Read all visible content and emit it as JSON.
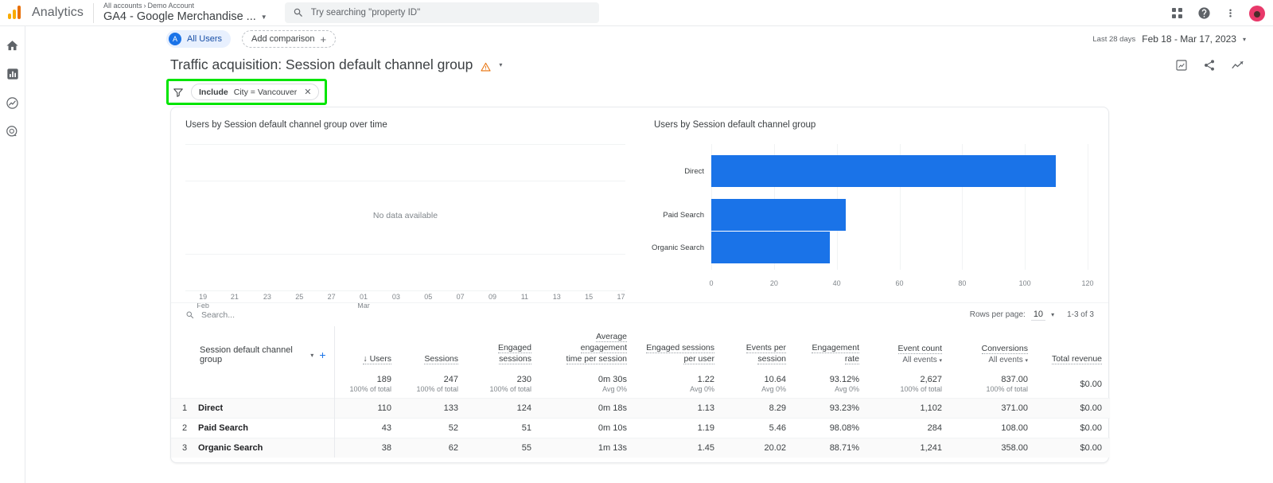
{
  "topbar": {
    "brand": "Analytics",
    "breadcrumb_accounts": "All accounts",
    "breadcrumb_sep": "›",
    "breadcrumb_account": "Demo Account",
    "property": "GA4 - Google Merchandise ...",
    "search_placeholder": "Try searching \"property ID\"",
    "icons": [
      "search-icon",
      "apps-grid-icon",
      "help-icon",
      "more-vert-icon",
      "avatar"
    ]
  },
  "sidebar": {
    "items": [
      {
        "name": "home",
        "icon": "home-icon"
      },
      {
        "name": "reports",
        "icon": "bar-chart-icon"
      },
      {
        "name": "explore",
        "icon": "explore-icon"
      },
      {
        "name": "advertising",
        "icon": "advertising-icon"
      }
    ]
  },
  "comparison": {
    "all_users_initial": "A",
    "all_users_label": "All Users",
    "add_comparison_label": "Add comparison",
    "add_comparison_plus": "+"
  },
  "daterange": {
    "relative": "Last 28 days",
    "absolute": "Feb 18 - Mar 17, 2023",
    "caret": "▾"
  },
  "report": {
    "title": "Traffic acquisition: Session default channel group",
    "warning_icon": "warning-triangle-icon",
    "title_caret": "▾",
    "actions": [
      "customize-report-icon",
      "share-icon",
      "insights-icon"
    ]
  },
  "filter": {
    "icon": "filter-funnel-icon",
    "include_label": "Include",
    "condition": "City = Vancouver",
    "remove": "✕",
    "highlight_color": "#00e500"
  },
  "chart_data": [
    {
      "type": "line",
      "title": "Users by Session default channel group over time",
      "empty_message": "No data available",
      "xlabel": "",
      "ylabel": "",
      "x_ticks": [
        {
          "top": "19",
          "bottom": "Feb"
        },
        {
          "top": "21",
          "bottom": ""
        },
        {
          "top": "23",
          "bottom": ""
        },
        {
          "top": "25",
          "bottom": ""
        },
        {
          "top": "27",
          "bottom": ""
        },
        {
          "top": "01",
          "bottom": "Mar"
        },
        {
          "top": "03",
          "bottom": ""
        },
        {
          "top": "05",
          "bottom": ""
        },
        {
          "top": "07",
          "bottom": ""
        },
        {
          "top": "09",
          "bottom": ""
        },
        {
          "top": "11",
          "bottom": ""
        },
        {
          "top": "13",
          "bottom": ""
        },
        {
          "top": "15",
          "bottom": ""
        },
        {
          "top": "17",
          "bottom": ""
        }
      ],
      "series": [],
      "grid": true
    },
    {
      "type": "bar",
      "orientation": "horizontal",
      "title": "Users by Session default channel group",
      "categories": [
        "Direct",
        "Paid Search",
        "Organic Search"
      ],
      "values": [
        110,
        43,
        38
      ],
      "xlabel": "",
      "ylabel": "",
      "xlim": [
        0,
        120
      ],
      "x_ticks": [
        0,
        20,
        40,
        60,
        80,
        100,
        120
      ],
      "bar_color": "#1a73e8",
      "grid": true,
      "legend": "none"
    }
  ],
  "table": {
    "search_placeholder": "Search...",
    "rows_per_page_label": "Rows per page:",
    "rows_per_page_value": "10",
    "rows_per_page_caret": "▾",
    "range_label": "1-3 of 3",
    "dimension": {
      "label": "Session default channel group",
      "caret": "▾",
      "plus": "+"
    },
    "columns": [
      {
        "line1": "Users",
        "line2": "",
        "sub": "",
        "sorted": true,
        "sort_arrow": "↓"
      },
      {
        "line1": "Sessions",
        "line2": "",
        "sub": ""
      },
      {
        "line1": "Engaged",
        "line2": "sessions",
        "sub": ""
      },
      {
        "line1": "Average engagement",
        "line2": "time per session",
        "sub": ""
      },
      {
        "line1": "Engaged sessions",
        "line2": "per user",
        "sub": ""
      },
      {
        "line1": "Events per",
        "line2": "session",
        "sub": ""
      },
      {
        "line1": "Engagement",
        "line2": "rate",
        "sub": ""
      },
      {
        "line1": "Event count",
        "line2": "",
        "sub": "All events"
      },
      {
        "line1": "Conversions",
        "line2": "",
        "sub": "All events"
      },
      {
        "line1": "Total revenue",
        "line2": "",
        "sub": ""
      }
    ],
    "totals": {
      "values": [
        "189",
        "247",
        "230",
        "0m 30s",
        "1.22",
        "10.64",
        "93.12%",
        "2,627",
        "837.00",
        "$0.00"
      ],
      "subs": [
        "100% of total",
        "100% of total",
        "100% of total",
        "Avg 0%",
        "Avg 0%",
        "Avg 0%",
        "Avg 0%",
        "100% of total",
        "100% of total",
        ""
      ]
    },
    "rows": [
      {
        "index": "1",
        "name": "Direct",
        "values": [
          "110",
          "133",
          "124",
          "0m 18s",
          "1.13",
          "8.29",
          "93.23%",
          "1,102",
          "371.00",
          "$0.00"
        ]
      },
      {
        "index": "2",
        "name": "Paid Search",
        "values": [
          "43",
          "52",
          "51",
          "0m 10s",
          "1.19",
          "5.46",
          "98.08%",
          "284",
          "108.00",
          "$0.00"
        ]
      },
      {
        "index": "3",
        "name": "Organic Search",
        "values": [
          "38",
          "62",
          "55",
          "1m 13s",
          "1.45",
          "20.02",
          "88.71%",
          "1,241",
          "358.00",
          "$0.00"
        ]
      }
    ]
  }
}
